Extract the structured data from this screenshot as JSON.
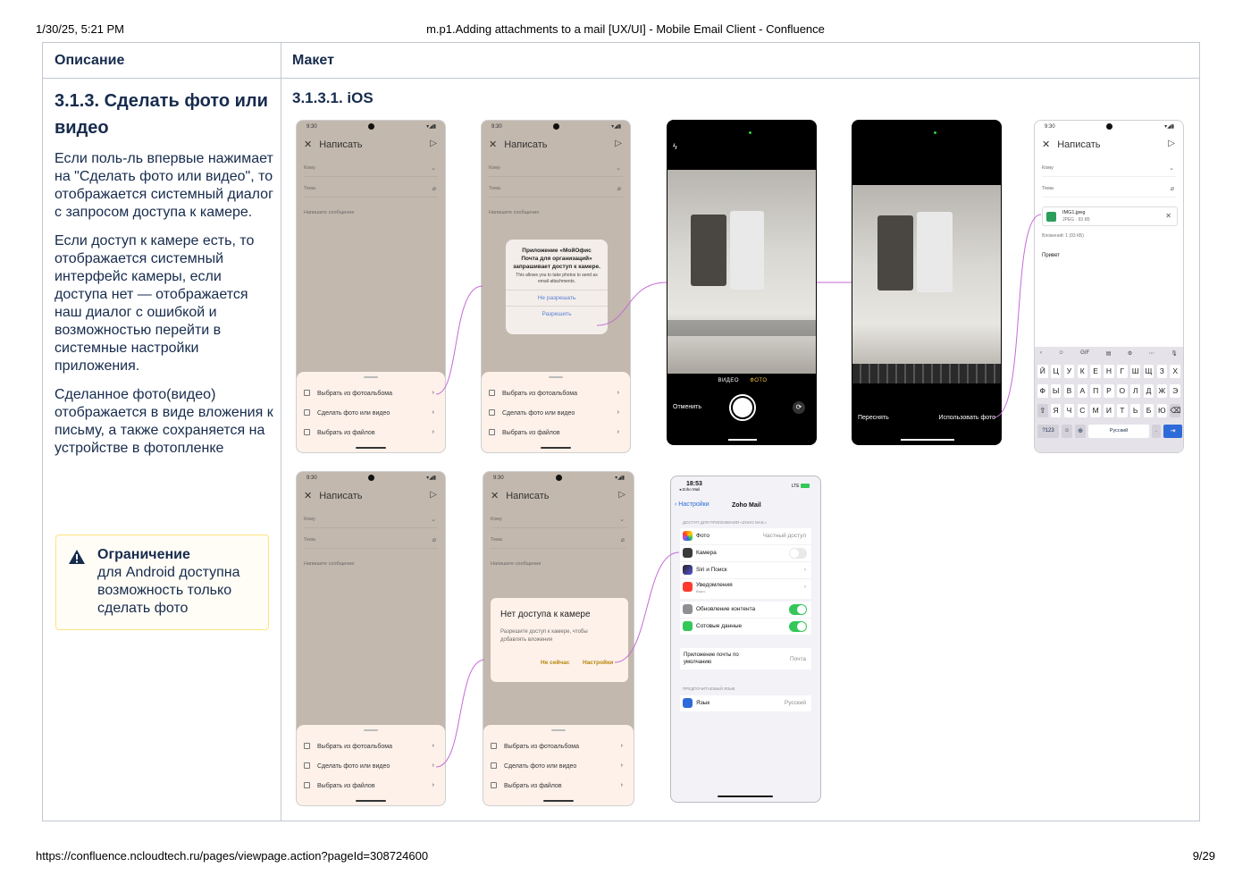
{
  "print": {
    "date": "1/30/25, 5:21 PM",
    "title": "m.p1.Adding attachments to a mail [UX/UI] - Mobile Email Client - Confluence",
    "url": "https://confluence.ncloudtech.ru/pages/viewpage.action?pageId=308724600",
    "page": "9/29"
  },
  "table": {
    "col1_header": "Описание",
    "col2_header": "Макет"
  },
  "description": {
    "heading": "3.1.3.  Сделать фото или видео",
    "p1": "Если поль-ль впервые нажимает на \"Сделать фото или видео\", то отображается системный диалог с запросом доступа к камере.",
    "p2": "Если доступ к камере есть, то отображается системный интерфейс камеры, если доступа нет — отображается наш диалог с ошибкой и возможностью перейти в системные настройки приложения.",
    "p3": "Сделанное фото(видео) отображается в виде вложения к письму, а также сохраняется на устройстве в фотопленке"
  },
  "warning": {
    "title": "Ограничение",
    "body": "для Android доступна возможность только сделать фото",
    "icon": "warning-icon"
  },
  "mockup": {
    "subheading": "3.1.3.1. iOS",
    "time": "9:30",
    "compose_title": "Написать",
    "to_label": "Кому",
    "subject_label": "Тема",
    "body_placeholder": "Напишите сообщение",
    "sheet_items": [
      "Выбрать из фотоальбома",
      "Сделать фото или видео",
      "Выбрать из файлов"
    ],
    "permission_dialog": {
      "title": "Приложение «МойОфис Почта для организаций» запрашивает доступ к камере.",
      "desc": "This allows you to take photos to send as email attachments.",
      "deny": "Не разрешать",
      "allow": "Разрешить"
    },
    "camera": {
      "mode_video": "ВИДЕО",
      "mode_photo": "ФОТО",
      "cancel": "Отменить",
      "retake": "Переснять",
      "use_photo": "Использовать фото"
    },
    "attachment": {
      "name": "IMG1.jpeg",
      "meta": "JPEG · 93 КБ",
      "summary": "Вложений: 1 (93 КБ)",
      "body_text": "Привет"
    },
    "keyboard": {
      "row1": [
        "Й",
        "Ц",
        "У",
        "К",
        "Е",
        "Н",
        "Г",
        "Ш",
        "Щ",
        "З",
        "Х"
      ],
      "row2": [
        "Ф",
        "Ы",
        "В",
        "А",
        "П",
        "Р",
        "О",
        "Л",
        "Д",
        "Ж",
        "Э"
      ],
      "row3": [
        "Я",
        "Ч",
        "С",
        "М",
        "И",
        "Т",
        "Ь",
        "Б",
        "Ю"
      ],
      "num_key": "?123",
      "space_label": "Русский",
      "gif": "GIF"
    },
    "no_access_dialog": {
      "title": "Нет доступа к камере",
      "desc": "Разрешите доступ к камере, чтобы добавлять вложения",
      "later": "Не сейчас",
      "settings": "Настройки"
    },
    "ios_settings": {
      "time": "18:53",
      "back_app": "◂ Zoho Mail",
      "network": "LTE",
      "back": "Настройки",
      "title": "Zoho Mail",
      "section1": "ДОСТУП ДЛЯ ПРИЛОЖЕНИЯ «ZOHO MAIL»",
      "rows": [
        {
          "label": "Фото",
          "value": "Частный доступ"
        },
        {
          "label": "Камера",
          "value": ""
        },
        {
          "label": "Siri и Поиск",
          "value": ""
        },
        {
          "label": "Уведомления",
          "value": "Выкл."
        },
        {
          "label": "Обновление контента",
          "value": ""
        },
        {
          "label": "Сотовые данные",
          "value": ""
        }
      ],
      "default_mail_label": "Приложение почты по умолчанию",
      "default_mail_value": "Почта",
      "section2": "ПРЕДПОЧИТАЕМЫЙ ЯЗЫК",
      "lang_label": "Язык",
      "lang_value": "Русский"
    }
  },
  "colors": {
    "text": "#172b4d",
    "border": "#c1c7d0",
    "warning_border": "#ffe380",
    "connector": "#c56bd6",
    "beige": "#c2b8ae",
    "sheet": "#fdf1ea",
    "ios_green": "#34c759",
    "accent_blue": "#2f6bd8"
  }
}
